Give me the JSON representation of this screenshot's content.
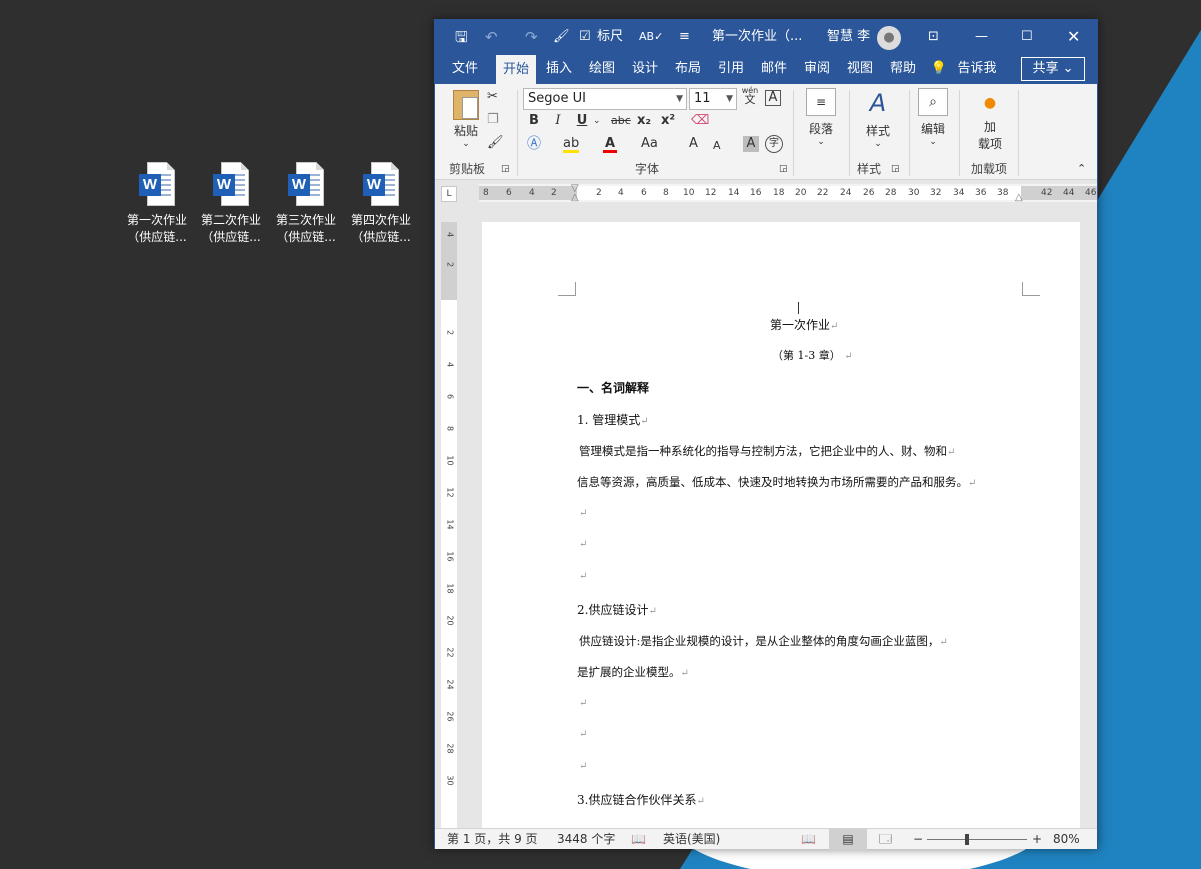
{
  "desktop": {
    "icons": [
      {
        "line1": "第一次作业",
        "line2": "（供应链..."
      },
      {
        "line1": "第二次作业",
        "line2": "（供应链..."
      },
      {
        "line1": "第三次作业",
        "line2": "（供应链..."
      },
      {
        "line1": "第四次作业",
        "line2": "（供应链..."
      }
    ]
  },
  "titlebar": {
    "ruler_label": "标尺",
    "doc_title": "第一次作业（...",
    "user_name": "智慧 李"
  },
  "menu": {
    "items": [
      "文件",
      "开始",
      "插入",
      "绘图",
      "设计",
      "布局",
      "引用",
      "邮件",
      "审阅",
      "视图",
      "帮助"
    ],
    "tell_me": "告诉我",
    "share": "共享"
  },
  "ribbon": {
    "paste": "粘贴",
    "clipboard": "剪贴板",
    "font_name": "Segoe UI",
    "font_size": "11",
    "font_group": "字体",
    "bold": "B",
    "italic": "I",
    "underline": "U",
    "strike": "abc",
    "subscript": "x₂",
    "superscript": "x²",
    "change_case": "Aa",
    "grow": "A",
    "shrink": "A",
    "paragraph": "段落",
    "styles": "样式",
    "styles_group": "样式",
    "editing": "编辑",
    "addins_btn_1": "加",
    "addins_btn_2": "载项",
    "addins_group": "加载项",
    "wen": "wén",
    "wen_char": "文",
    "zi_char": "字"
  },
  "ruler": {
    "h_numbers": [
      "8",
      "6",
      "4",
      "2",
      "2",
      "4",
      "6",
      "8",
      "10",
      "12",
      "14",
      "16",
      "18",
      "20",
      "22",
      "24",
      "26",
      "28",
      "30",
      "32",
      "34",
      "36",
      "38",
      "42",
      "44",
      "46"
    ],
    "v_numbers": [
      "4",
      "2",
      "2",
      "4",
      "6",
      "8",
      "10",
      "12",
      "14",
      "16",
      "18",
      "20",
      "22",
      "24",
      "26",
      "28",
      "30"
    ]
  },
  "document": {
    "title": "第一次作业",
    "subtitle": "（第 1-3 章）",
    "section1": "一、名词解释",
    "item1_head": "1. 管理模式",
    "item1_text_a": "管理模式是指一种系统化的指导与控制方法，它把企业中的人、财、物和",
    "item1_text_b": "信息等资源，高质量、低成本、快速及时地转换为市场所需要的产品和服务。",
    "item2_head": "2.供应链设计",
    "item2_text_a": "供应链设计:是指企业规模的设计，是从企业整体的角度勾画企业蓝图，",
    "item2_text_b": "是扩展的企业模型。",
    "item3_head": "3.供应链合作伙伴关系",
    "para_mark": "↵"
  },
  "status": {
    "page": "第 1 页，共 9 页",
    "words": "3448 个字",
    "lang": "英语(美国)",
    "zoom": "80%"
  },
  "colors": {
    "word_blue": "#2b579a",
    "desktop_bg": "#2f2f2f",
    "wallpaper_blue": "#1f83c1"
  }
}
